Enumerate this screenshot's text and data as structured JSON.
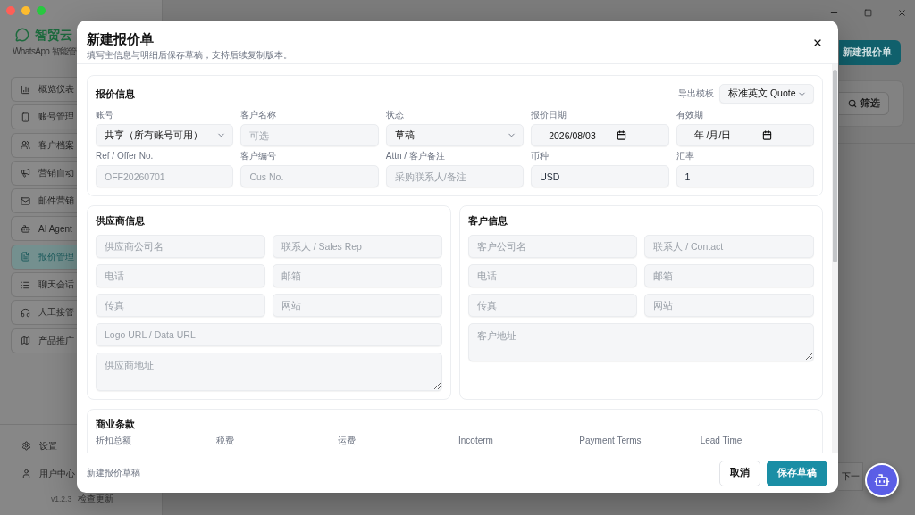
{
  "sidebar": {
    "brand": "智贸云",
    "tagline": "WhatsApp 智能管",
    "items": [
      {
        "label": "概览仪表",
        "selected": false
      },
      {
        "label": "账号管理",
        "selected": false
      },
      {
        "label": "客户档案",
        "selected": false
      },
      {
        "label": "营销自动",
        "selected": false
      },
      {
        "label": "邮件营销",
        "selected": false
      },
      {
        "label": "AI Agent",
        "selected": false
      },
      {
        "label": "报价管理",
        "selected": true
      },
      {
        "label": "聊天会话",
        "selected": false
      },
      {
        "label": "人工接管",
        "selected": false
      },
      {
        "label": "产品推广",
        "selected": false
      }
    ],
    "footer_items": [
      {
        "label": "设置"
      },
      {
        "label": "用户中心"
      }
    ],
    "version": "v1.2.3",
    "update_link": "检查更新"
  },
  "main": {
    "new_button": "新建报价单",
    "filter_button": "筛选",
    "next_page_button": "下一"
  },
  "modal": {
    "title": "新建报价单",
    "subtitle": "填写主信息与明细后保存草稿，支持后续复制版本。",
    "quote_info": {
      "title": "报价信息",
      "template": {
        "label": "导出模板",
        "value": "标准英文 Quote"
      },
      "fields": [
        {
          "label": "账号",
          "kind": "select",
          "value": "共享（所有账号可用）"
        },
        {
          "label": "客户名称",
          "kind": "text",
          "placeholder": "可选"
        },
        {
          "label": "状态",
          "kind": "select",
          "value": "草稿"
        },
        {
          "label": "报价日期",
          "kind": "date",
          "value": "2026/08/03"
        },
        {
          "label": "有效期",
          "kind": "date",
          "value": "年 /月/日"
        },
        {
          "label": "Ref / Offer No.",
          "kind": "text",
          "placeholder": "OFF20260701"
        },
        {
          "label": "客户编号",
          "kind": "text",
          "placeholder": "Cus No."
        },
        {
          "label": "Attn / 客户备注",
          "kind": "text",
          "placeholder": "采购联系人/备注"
        },
        {
          "label": "币种",
          "kind": "text",
          "value": "USD"
        },
        {
          "label": "汇率",
          "kind": "text",
          "value": "1"
        }
      ]
    },
    "supplier": {
      "title": "供应商信息",
      "fields": [
        {
          "kind": "text",
          "placeholder": "供应商公司名"
        },
        {
          "kind": "text",
          "placeholder": "联系人 / Sales Rep"
        },
        {
          "kind": "text",
          "placeholder": "电话"
        },
        {
          "kind": "text",
          "placeholder": "邮箱"
        },
        {
          "kind": "text",
          "placeholder": "传真"
        },
        {
          "kind": "text",
          "placeholder": "网站"
        },
        {
          "kind": "wide",
          "placeholder": "Logo URL / Data URL"
        },
        {
          "kind": "textarea",
          "placeholder": "供应商地址"
        }
      ]
    },
    "customer": {
      "title": "客户信息",
      "fields": [
        {
          "kind": "text",
          "placeholder": "客户公司名"
        },
        {
          "kind": "text",
          "placeholder": "联系人 / Contact"
        },
        {
          "kind": "text",
          "placeholder": "电话"
        },
        {
          "kind": "text",
          "placeholder": "邮箱"
        },
        {
          "kind": "text",
          "placeholder": "传真"
        },
        {
          "kind": "text",
          "placeholder": "网站"
        },
        {
          "kind": "textarea",
          "placeholder": "客户地址"
        }
      ]
    },
    "terms": {
      "title": "商业条款",
      "columns": [
        "折扣总额",
        "税费",
        "运费",
        "Incoterm",
        "Payment Terms",
        "Lead Time"
      ]
    },
    "footer": {
      "note": "新建报价草稿",
      "buttons": [
        {
          "kind": "secondary",
          "label": "取消"
        },
        {
          "kind": "primary",
          "label": "保存草稿"
        }
      ]
    }
  }
}
